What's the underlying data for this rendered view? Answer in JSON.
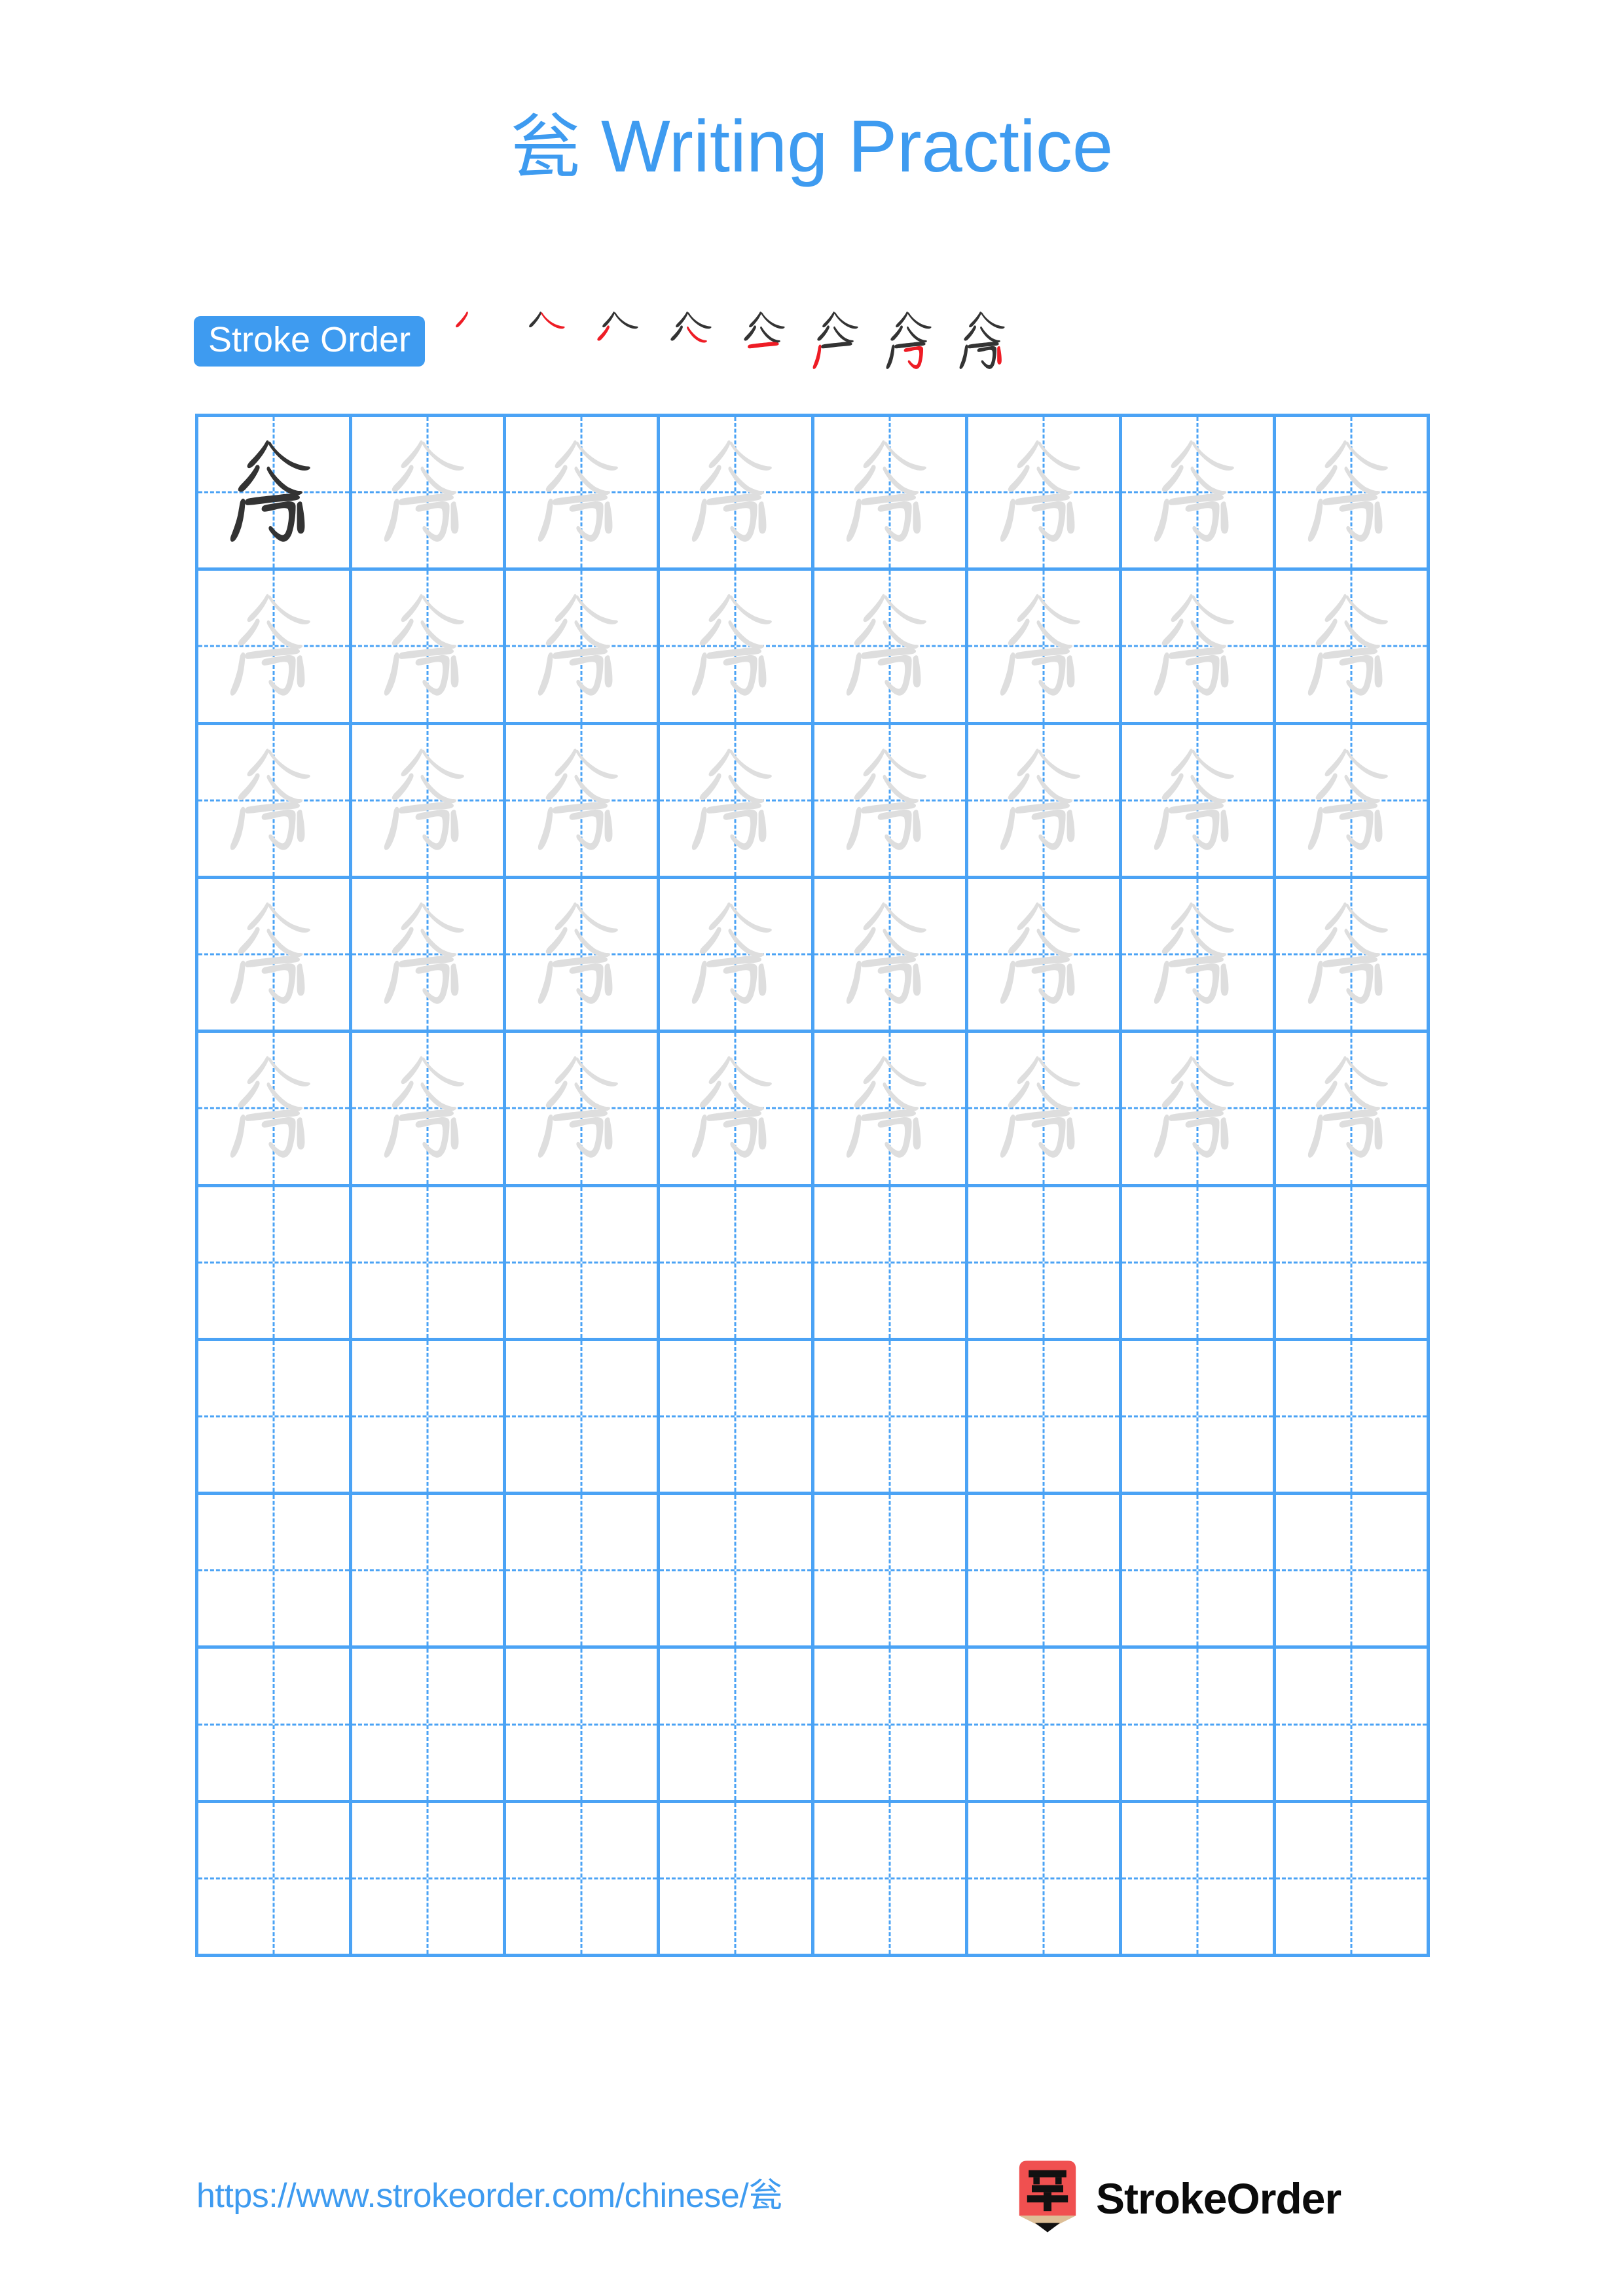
{
  "page": {
    "character": "瓮",
    "title": "瓮 Writing Practice",
    "title_character": "瓮",
    "title_text": " Writing Practice",
    "background_color": "#ffffff",
    "accent_color": "#3E9BF0",
    "grid_line_color": "#4BA3F5",
    "traced_character_color": "#DEDEDE",
    "solid_character_color": "#333333",
    "new_stroke_color": "#EE1C25"
  },
  "stroke_order": {
    "badge_label": "Stroke Order",
    "stroke_count": 8,
    "steps": [
      {
        "index": 1,
        "strokes_shown": 1,
        "new_stroke_index": 1
      },
      {
        "index": 2,
        "strokes_shown": 2,
        "new_stroke_index": 2
      },
      {
        "index": 3,
        "strokes_shown": 3,
        "new_stroke_index": 3
      },
      {
        "index": 4,
        "strokes_shown": 4,
        "new_stroke_index": 4
      },
      {
        "index": 5,
        "strokes_shown": 5,
        "new_stroke_index": 5
      },
      {
        "index": 6,
        "strokes_shown": 6,
        "new_stroke_index": 6
      },
      {
        "index": 7,
        "strokes_shown": 7,
        "new_stroke_index": 7
      },
      {
        "index": 8,
        "strokes_shown": 8,
        "new_stroke_index": 8
      }
    ]
  },
  "practice_grid": {
    "columns": 8,
    "rows": 10,
    "filled_rows": 5,
    "empty_rows": 5,
    "first_cell_style": "solid",
    "traced_cell_style": "light-gray",
    "cells": [
      [
        "solid",
        "traced",
        "traced",
        "traced",
        "traced",
        "traced",
        "traced",
        "traced"
      ],
      [
        "traced",
        "traced",
        "traced",
        "traced",
        "traced",
        "traced",
        "traced",
        "traced"
      ],
      [
        "traced",
        "traced",
        "traced",
        "traced",
        "traced",
        "traced",
        "traced",
        "traced"
      ],
      [
        "traced",
        "traced",
        "traced",
        "traced",
        "traced",
        "traced",
        "traced",
        "traced"
      ],
      [
        "traced",
        "traced",
        "traced",
        "traced",
        "traced",
        "traced",
        "traced",
        "traced"
      ],
      [
        "empty",
        "empty",
        "empty",
        "empty",
        "empty",
        "empty",
        "empty",
        "empty"
      ],
      [
        "empty",
        "empty",
        "empty",
        "empty",
        "empty",
        "empty",
        "empty",
        "empty"
      ],
      [
        "empty",
        "empty",
        "empty",
        "empty",
        "empty",
        "empty",
        "empty",
        "empty"
      ],
      [
        "empty",
        "empty",
        "empty",
        "empty",
        "empty",
        "empty",
        "empty",
        "empty"
      ],
      [
        "empty",
        "empty",
        "empty",
        "empty",
        "empty",
        "empty",
        "empty",
        "empty"
      ]
    ]
  },
  "footer": {
    "url": "https://www.strokeorder.com/chinese/瓮",
    "brand_name": "StrokeOrder",
    "logo": {
      "icon_character": "字",
      "body_color": "#F05050",
      "wood_color": "#DDBE96",
      "tip_color": "#111111"
    }
  }
}
